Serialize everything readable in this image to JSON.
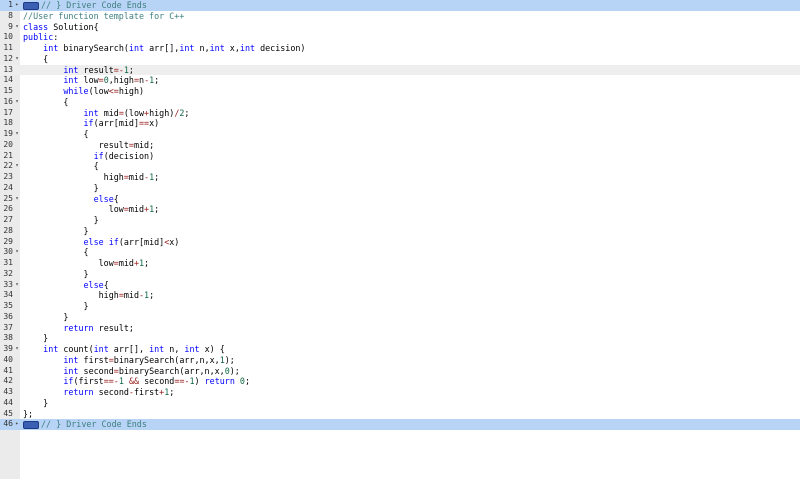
{
  "editor": {
    "colors": {
      "keyword": "#0000ff",
      "number": "#116644",
      "operator": "#981a1a",
      "comment": "#3f7f7f",
      "fold_highlight": "#b7d3f5"
    },
    "active_line": "13",
    "lines": [
      {
        "n": "1",
        "fold": "▸",
        "style": "fold-marker",
        "tokens": [
          {
            "t": "w"
          },
          {
            "t": "cm",
            "v": "// } Driver Code Ends"
          }
        ]
      },
      {
        "n": "8",
        "fold": "",
        "tokens": [
          {
            "t": "cm",
            "v": "//User function template for C++"
          }
        ]
      },
      {
        "n": "9",
        "fold": "▾",
        "tokens": [
          {
            "t": "kw",
            "v": "class"
          },
          {
            "v": " Solution{"
          }
        ]
      },
      {
        "n": "10",
        "fold": "",
        "tokens": [
          {
            "t": "kw",
            "v": "public"
          },
          {
            "v": ":"
          }
        ]
      },
      {
        "n": "11",
        "fold": "",
        "tokens": [
          {
            "v": "    "
          },
          {
            "t": "kw",
            "v": "int"
          },
          {
            "v": " binarySearch("
          },
          {
            "t": "kw",
            "v": "int"
          },
          {
            "v": " arr[],"
          },
          {
            "t": "kw",
            "v": "int"
          },
          {
            "v": " n,"
          },
          {
            "t": "kw",
            "v": "int"
          },
          {
            "v": " x,"
          },
          {
            "t": "kw",
            "v": "int"
          },
          {
            "v": " decision)"
          }
        ]
      },
      {
        "n": "12",
        "fold": "▾",
        "tokens": [
          {
            "v": "    {"
          }
        ]
      },
      {
        "n": "13",
        "fold": "",
        "style": "active",
        "tokens": [
          {
            "v": "        "
          },
          {
            "t": "kw",
            "v": "int"
          },
          {
            "v": " result"
          },
          {
            "t": "op",
            "v": "=-"
          },
          {
            "t": "num",
            "v": "1"
          },
          {
            "v": ";"
          }
        ]
      },
      {
        "n": "14",
        "fold": "",
        "tokens": [
          {
            "v": "        "
          },
          {
            "t": "kw",
            "v": "int"
          },
          {
            "v": " low"
          },
          {
            "t": "op",
            "v": "="
          },
          {
            "t": "num",
            "v": "0"
          },
          {
            "v": ",high"
          },
          {
            "t": "op",
            "v": "="
          },
          {
            "v": "n"
          },
          {
            "t": "op",
            "v": "-"
          },
          {
            "t": "num",
            "v": "1"
          },
          {
            "v": ";"
          }
        ]
      },
      {
        "n": "15",
        "fold": "",
        "tokens": [
          {
            "v": "        "
          },
          {
            "t": "kw",
            "v": "while"
          },
          {
            "v": "(low"
          },
          {
            "t": "op",
            "v": "<="
          },
          {
            "v": "high)"
          }
        ]
      },
      {
        "n": "16",
        "fold": "▾",
        "tokens": [
          {
            "v": "        {"
          }
        ]
      },
      {
        "n": "17",
        "fold": "",
        "tokens": [
          {
            "v": "            "
          },
          {
            "t": "kw",
            "v": "int"
          },
          {
            "v": " mid"
          },
          {
            "t": "op",
            "v": "="
          },
          {
            "v": "(low"
          },
          {
            "t": "op",
            "v": "+"
          },
          {
            "v": "high)"
          },
          {
            "t": "op",
            "v": "/"
          },
          {
            "t": "num",
            "v": "2"
          },
          {
            "v": ";"
          }
        ]
      },
      {
        "n": "18",
        "fold": "",
        "tokens": [
          {
            "v": "            "
          },
          {
            "t": "kw",
            "v": "if"
          },
          {
            "v": "(arr[mid]"
          },
          {
            "t": "op",
            "v": "=="
          },
          {
            "v": "x)"
          }
        ]
      },
      {
        "n": "19",
        "fold": "▾",
        "tokens": [
          {
            "v": "            {"
          }
        ]
      },
      {
        "n": "20",
        "fold": "",
        "tokens": [
          {
            "v": "               result"
          },
          {
            "t": "op",
            "v": "="
          },
          {
            "v": "mid;"
          }
        ]
      },
      {
        "n": "21",
        "fold": "",
        "tokens": [
          {
            "v": "              "
          },
          {
            "t": "kw",
            "v": "if"
          },
          {
            "v": "(decision)"
          }
        ]
      },
      {
        "n": "22",
        "fold": "▾",
        "tokens": [
          {
            "v": "              {"
          }
        ]
      },
      {
        "n": "23",
        "fold": "",
        "tokens": [
          {
            "v": "                high"
          },
          {
            "t": "op",
            "v": "="
          },
          {
            "v": "mid"
          },
          {
            "t": "op",
            "v": "-"
          },
          {
            "t": "num",
            "v": "1"
          },
          {
            "v": ";"
          }
        ]
      },
      {
        "n": "24",
        "fold": "",
        "tokens": [
          {
            "v": "              }"
          }
        ]
      },
      {
        "n": "25",
        "fold": "▾",
        "tokens": [
          {
            "v": "              "
          },
          {
            "t": "kw",
            "v": "else"
          },
          {
            "v": "{"
          }
        ]
      },
      {
        "n": "26",
        "fold": "",
        "tokens": [
          {
            "v": "                 low"
          },
          {
            "t": "op",
            "v": "="
          },
          {
            "v": "mid"
          },
          {
            "t": "op",
            "v": "+"
          },
          {
            "t": "num",
            "v": "1"
          },
          {
            "v": ";"
          }
        ]
      },
      {
        "n": "27",
        "fold": "",
        "tokens": [
          {
            "v": "              }"
          }
        ]
      },
      {
        "n": "28",
        "fold": "",
        "tokens": [
          {
            "v": "            }"
          }
        ]
      },
      {
        "n": "29",
        "fold": "",
        "tokens": [
          {
            "v": "            "
          },
          {
            "t": "kw",
            "v": "else"
          },
          {
            "v": " "
          },
          {
            "t": "kw",
            "v": "if"
          },
          {
            "v": "(arr[mid]"
          },
          {
            "t": "op",
            "v": "<"
          },
          {
            "v": "x)"
          }
        ]
      },
      {
        "n": "30",
        "fold": "▾",
        "tokens": [
          {
            "v": "            {"
          }
        ]
      },
      {
        "n": "31",
        "fold": "",
        "tokens": [
          {
            "v": "               low"
          },
          {
            "t": "op",
            "v": "="
          },
          {
            "v": "mid"
          },
          {
            "t": "op",
            "v": "+"
          },
          {
            "t": "num",
            "v": "1"
          },
          {
            "v": ";"
          }
        ]
      },
      {
        "n": "32",
        "fold": "",
        "tokens": [
          {
            "v": "            }"
          }
        ]
      },
      {
        "n": "33",
        "fold": "▾",
        "tokens": [
          {
            "v": "            "
          },
          {
            "t": "kw",
            "v": "else"
          },
          {
            "v": "{"
          }
        ]
      },
      {
        "n": "34",
        "fold": "",
        "tokens": [
          {
            "v": "               high"
          },
          {
            "t": "op",
            "v": "="
          },
          {
            "v": "mid"
          },
          {
            "t": "op",
            "v": "-"
          },
          {
            "t": "num",
            "v": "1"
          },
          {
            "v": ";"
          }
        ]
      },
      {
        "n": "35",
        "fold": "",
        "tokens": [
          {
            "v": "            }"
          }
        ]
      },
      {
        "n": "36",
        "fold": "",
        "tokens": [
          {
            "v": "        }"
          }
        ]
      },
      {
        "n": "37",
        "fold": "",
        "tokens": [
          {
            "v": "        "
          },
          {
            "t": "kw",
            "v": "return"
          },
          {
            "v": " result;"
          }
        ]
      },
      {
        "n": "38",
        "fold": "",
        "tokens": [
          {
            "v": "    }"
          }
        ]
      },
      {
        "n": "39",
        "fold": "▾",
        "tokens": [
          {
            "v": "    "
          },
          {
            "t": "kw",
            "v": "int"
          },
          {
            "v": " count("
          },
          {
            "t": "kw",
            "v": "int"
          },
          {
            "v": " arr[], "
          },
          {
            "t": "kw",
            "v": "int"
          },
          {
            "v": " n, "
          },
          {
            "t": "kw",
            "v": "int"
          },
          {
            "v": " x) {"
          }
        ]
      },
      {
        "n": "40",
        "fold": "",
        "tokens": [
          {
            "v": "        "
          },
          {
            "t": "kw",
            "v": "int"
          },
          {
            "v": " first"
          },
          {
            "t": "op",
            "v": "="
          },
          {
            "v": "binarySearch(arr,n,x,"
          },
          {
            "t": "num",
            "v": "1"
          },
          {
            "v": ");"
          }
        ]
      },
      {
        "n": "41",
        "fold": "",
        "tokens": [
          {
            "v": "        "
          },
          {
            "t": "kw",
            "v": "int"
          },
          {
            "v": " second"
          },
          {
            "t": "op",
            "v": "="
          },
          {
            "v": "binarySearch(arr,n,x,"
          },
          {
            "t": "num",
            "v": "0"
          },
          {
            "v": ");"
          }
        ]
      },
      {
        "n": "42",
        "fold": "",
        "tokens": [
          {
            "v": "        "
          },
          {
            "t": "kw",
            "v": "if"
          },
          {
            "v": "(first"
          },
          {
            "t": "op",
            "v": "==-"
          },
          {
            "t": "num",
            "v": "1"
          },
          {
            "v": " "
          },
          {
            "t": "op",
            "v": "&&"
          },
          {
            "v": " second"
          },
          {
            "t": "op",
            "v": "==-"
          },
          {
            "t": "num",
            "v": "1"
          },
          {
            "v": ") "
          },
          {
            "t": "kw",
            "v": "return"
          },
          {
            "v": " "
          },
          {
            "t": "num",
            "v": "0"
          },
          {
            "v": ";"
          }
        ]
      },
      {
        "n": "43",
        "fold": "",
        "tokens": [
          {
            "v": "        "
          },
          {
            "t": "kw",
            "v": "return"
          },
          {
            "v": " second"
          },
          {
            "t": "op",
            "v": "-"
          },
          {
            "v": "first"
          },
          {
            "t": "op",
            "v": "+"
          },
          {
            "t": "num",
            "v": "1"
          },
          {
            "v": ";"
          }
        ]
      },
      {
        "n": "44",
        "fold": "",
        "tokens": [
          {
            "v": "    }"
          }
        ]
      },
      {
        "n": "45",
        "fold": "",
        "tokens": [
          {
            "v": "};"
          }
        ]
      },
      {
        "n": "46",
        "fold": "▸",
        "style": "fold-marker",
        "tokens": [
          {
            "t": "w"
          },
          {
            "t": "cm",
            "v": "// } Driver Code Ends"
          }
        ]
      }
    ]
  }
}
